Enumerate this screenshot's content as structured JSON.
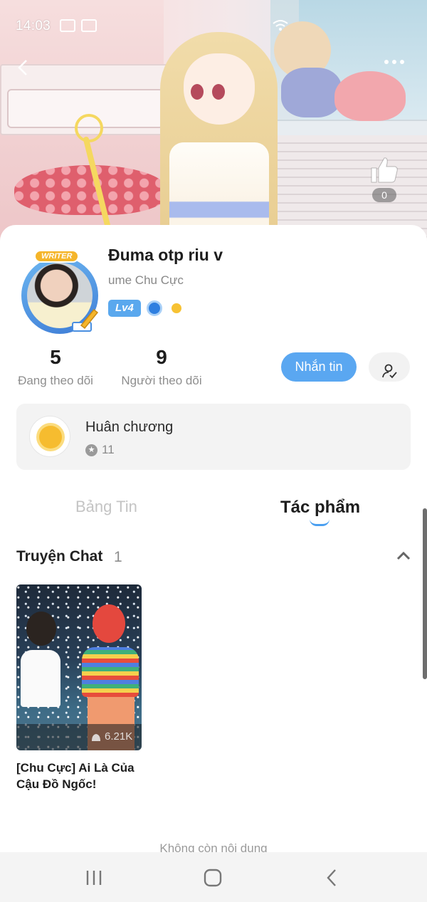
{
  "status_bar": {
    "time": "14:03"
  },
  "banner": {
    "like_count": "0"
  },
  "profile": {
    "avatar_badge": "WRITER",
    "name": "Đuma otp riu v",
    "subtitle": "ume Chu Cực",
    "level": "Lv4"
  },
  "stats": {
    "following_count": "5",
    "following_label": "Đang theo dõi",
    "followers_count": "9",
    "followers_label": "Người theo dõi"
  },
  "actions": {
    "message_label": "Nhắn tin"
  },
  "medal": {
    "title": "Huân chương",
    "count": "11"
  },
  "tabs": [
    {
      "label": "Bảng Tin",
      "active": false
    },
    {
      "label": "Tác phẩm",
      "active": true
    }
  ],
  "section": {
    "title": "Truyện Chat",
    "count": "1"
  },
  "works": [
    {
      "title": "[Chu Cực] Ai Là Của Cậu Đồ Ngốc!",
      "views": "6.21K"
    }
  ],
  "footer": {
    "end_text": "Không còn nội dung"
  },
  "colors": {
    "accent": "#5aa7f1",
    "level_badge": "#5aa8ee",
    "medal_gold": "#f6bc2f"
  },
  "icons": [
    "back-icon",
    "more-icon",
    "thumbs-up-icon",
    "user-follow-icon",
    "chevron-up-icon",
    "views-icon",
    "recents-icon",
    "home-icon",
    "nav-back-icon"
  ]
}
